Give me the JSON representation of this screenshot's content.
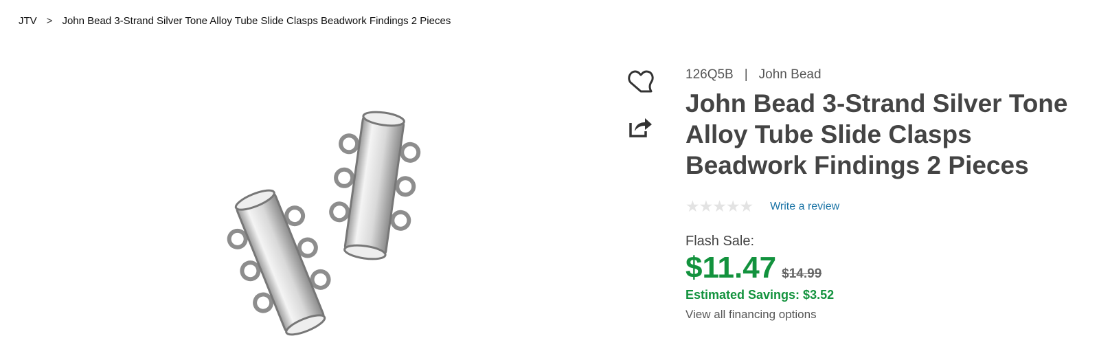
{
  "breadcrumb": {
    "home": "JTV",
    "separator": ">",
    "current": "John Bead 3-Strand Silver Tone Alloy Tube Slide Clasps Beadwork Findings 2 Pieces"
  },
  "product": {
    "sku": "126Q5B",
    "meta_separator": "|",
    "brand": "John Bead",
    "title": "John Bead 3-Strand Silver Tone Alloy Tube Slide Clasps Beadwork Findings 2 Pieces",
    "rating_stars": "★★★★★",
    "rating_value": 0,
    "rating_max": 5,
    "write_review": "Write a review",
    "flash_label": "Flash Sale:",
    "price": "$11.47",
    "original_price": "$14.99",
    "savings": "Estimated Savings: $3.52",
    "financing": "View all financing options"
  },
  "icons": {
    "wishlist": "heart-outline-icon",
    "share": "share-icon"
  },
  "colors": {
    "price_green": "#12923d",
    "link_blue": "#1b74a6",
    "star_empty": "#e3e3e3"
  }
}
